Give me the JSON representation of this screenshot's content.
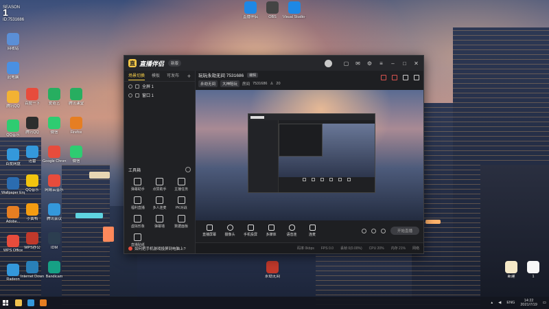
{
  "desktop": {
    "corner_badge": {
      "line1": "SEASON",
      "line2": "1",
      "line3": "ID:7531686"
    },
    "icons_col1": [
      {
        "label": "回收站",
        "color": "#5b8fd6"
      },
      {
        "label": "此电脑",
        "color": "#4a90e2"
      },
      {
        "label": "腾讯QQ",
        "color": "#f2b233"
      },
      {
        "label": "QQ音乐",
        "color": "#2ecc71"
      },
      {
        "label": "百度网盘",
        "color": "#3498db"
      },
      {
        "label": "Wallpaper Engine",
        "color": "#2b6cb0"
      },
      {
        "label": "Adobe...",
        "color": "#e67e22"
      },
      {
        "label": "WPS Office",
        "color": "#e74c3c"
      },
      {
        "label": "Radeon",
        "color": "#3498db"
      }
    ],
    "icons_col2": [
      {
        "label": "百度一下",
        "color": "#e74c3c"
      },
      {
        "label": "腾讯QQ",
        "color": "#2d2d2d"
      },
      {
        "label": "迅雷",
        "color": "#3498db"
      },
      {
        "label": "QQ音乐",
        "color": "#f1c40f"
      },
      {
        "label": "小黄鸭",
        "color": "#f39c12"
      },
      {
        "label": "WPS办公",
        "color": "#c0392b"
      },
      {
        "label": "Internet Download",
        "color": "#2980b9"
      }
    ],
    "icons_col3": [
      {
        "label": "爱奇艺",
        "color": "#27ae60"
      },
      {
        "label": "微信",
        "color": "#2ecc71"
      },
      {
        "label": "Google Chrome",
        "color": "#e74c3c"
      },
      {
        "label": "网易云音乐",
        "color": "#e74c3c"
      },
      {
        "label": "腾讯会议",
        "color": "#3498db"
      },
      {
        "label": "IDM",
        "color": "#2c3e50"
      },
      {
        "label": "Bandicam",
        "color": "#16a085"
      }
    ],
    "icons_col4": [
      {
        "label": "腾讯课堂",
        "color": "#27ae60"
      },
      {
        "label": "Firefox",
        "color": "#e67e22"
      },
      {
        "label": "微信",
        "color": "#2ecc71"
      }
    ],
    "icons_top": [
      {
        "label": "直播伴侣",
        "color": "#1e88e5"
      },
      {
        "label": "OBS",
        "color": "#444"
      },
      {
        "label": "Visual Studio Code",
        "color": "#1e88e5"
      }
    ],
    "icon_bottom_center": {
      "label": "永劫无间",
      "color": "#c0392b"
    },
    "icons_bottom_right": [
      {
        "label": "新建",
        "color": "#f5e9c8"
      },
      {
        "label": "1",
        "color": "#f7f7f7"
      }
    ]
  },
  "app": {
    "name": "直播伴侣",
    "version": "新版",
    "left_tabs": [
      "场景切换",
      "模板",
      "可发布"
    ],
    "scenes": [
      "全屏 1",
      "窗口 1"
    ],
    "tools_title": "工具箱",
    "tools": [
      "弹幕助手",
      "点赞助手",
      "主播任务",
      "福利直播",
      "多人连麦",
      "PK对战",
      "虚拟形象",
      "弹幕墙",
      "数据面板",
      "直播贴纸"
    ],
    "title": "玩玩永劫无间 7531686",
    "title_pill": "编辑",
    "tag1": "永劫无间",
    "tag2": "大神陪玩",
    "room_label": "房间",
    "room_id": "7531686",
    "viewers": "20",
    "controls": [
      "直播屏幕",
      "摄像头",
      "手机投屏",
      "多媒体",
      "语音连",
      "连麦"
    ],
    "live_button": "开始直播",
    "notice": "如何把手机游戏投屏到电脑上?",
    "status": [
      "码率 0kbps",
      "FPS 0.0",
      "丢帧 0(0.00%)",
      "CPU 20%",
      "内存 21%",
      "网络"
    ]
  },
  "taskbar": {
    "lang": "ENG",
    "time": "14:22",
    "date": "2021/7/19"
  }
}
